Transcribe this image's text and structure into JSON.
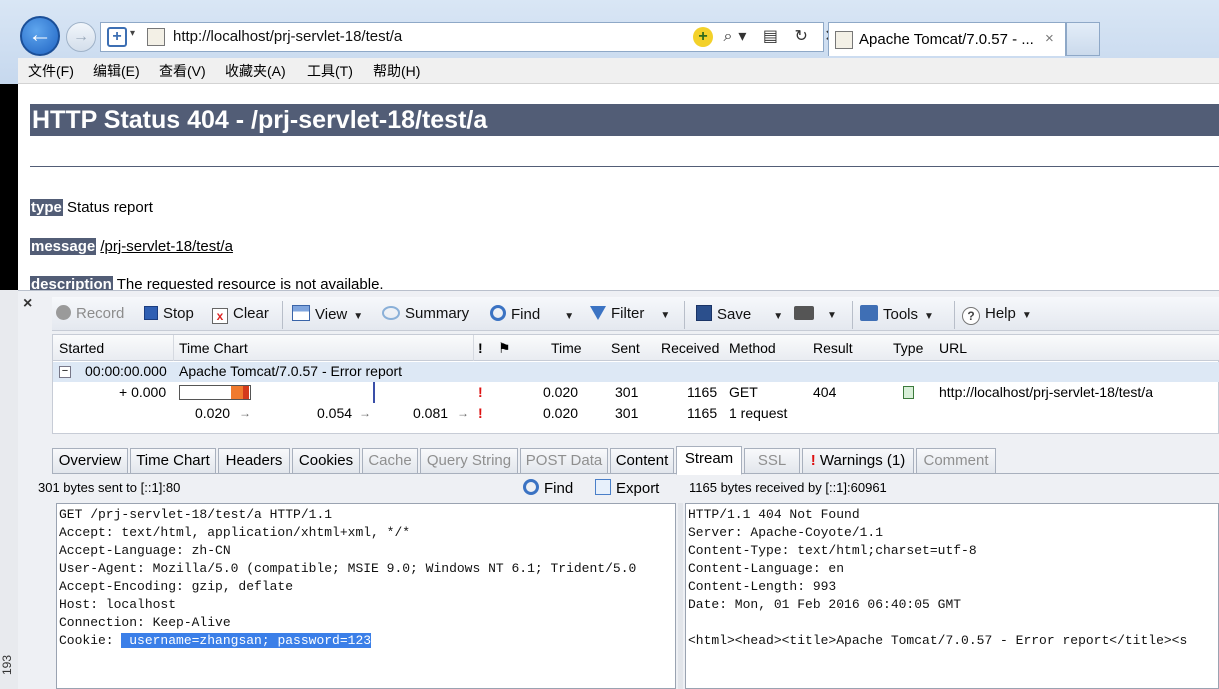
{
  "browser": {
    "url": "http://localhost/prj-servlet-18/test/a",
    "tab_title": "Apache Tomcat/7.0.57 - ...",
    "tab_close": "×",
    "back": "←",
    "forward": "→",
    "compat": "+",
    "compat_dd": "▾",
    "addr_icons": "⌕▾ ▤ ↻ ✕",
    "addr_add": "+",
    "menu": [
      "文件(F)",
      "编辑(E)",
      "查看(V)",
      "收藏夹(A)",
      "工具(T)",
      "帮助(H)"
    ]
  },
  "page": {
    "title": "HTTP Status 404 - /prj-servlet-18/test/a",
    "type_label": "type",
    "type_value": "Status report",
    "message_label": "message",
    "message_value": "/prj-servlet-18/test/a",
    "description_label": "description",
    "description_value": "The requested resource is not available."
  },
  "debugger": {
    "close": "×",
    "toolbar": {
      "record": "Record",
      "stop": "Stop",
      "clear": "Clear",
      "view": "View",
      "summary": "Summary",
      "find": "Find",
      "filter": "Filter",
      "save": "Save",
      "tools": "Tools",
      "help": "Help",
      "dropdown": "▼"
    },
    "columns": [
      "Started",
      "Time Chart",
      "!",
      "Time",
      "Sent",
      "Received",
      "Method",
      "Result",
      "Type",
      "URL"
    ],
    "group_row": {
      "expander": "−",
      "started": "00:00:00.000",
      "title": "Apache Tomcat/7.0.57 - Error report"
    },
    "entry_row": {
      "started": "+ 0.000",
      "flag": "!",
      "time": "0.020",
      "sent": "301",
      "received": "1165",
      "method": "GET",
      "result": "404",
      "url": "http://localhost/prj-servlet-18/test/a"
    },
    "summary_row": {
      "t1": "0.020",
      "t2": "0.054",
      "t3": "0.081",
      "arrow": "→",
      "flag": "!",
      "time": "0.020",
      "sent": "301",
      "received": "1165",
      "method": "1 request"
    },
    "tabs": [
      "Overview",
      "Time Chart",
      "Headers",
      "Cookies",
      "Cache",
      "Query String",
      "POST Data",
      "Content",
      "Stream",
      "SSL",
      "Warnings (1)",
      "Comment"
    ],
    "warn_mark": "!",
    "request_status": "301 bytes sent to [::1]:80",
    "response_status": "1165 bytes received by [::1]:60961",
    "find_label": "Find",
    "export_label": "Export",
    "request_lines": [
      "GET /prj-servlet-18/test/a HTTP/1.1",
      "Accept: text/html, application/xhtml+xml, */*",
      "Accept-Language: zh-CN",
      "User-Agent: Mozilla/5.0 (compatible; MSIE 9.0; Windows NT 6.1; Trident/5.0",
      "Accept-Encoding: gzip, deflate",
      "Host: localhost",
      "Connection: Keep-Alive"
    ],
    "cookie_label": "Cookie: ",
    "cookie_value": " username=zhangsan; password=123",
    "response_lines": [
      "HTTP/1.1 404 Not Found",
      "Server: Apache-Coyote/1.1",
      "Content-Type: text/html;charset=utf-8",
      "Content-Language: en",
      "Content-Length: 993",
      "Date: Mon, 01 Feb 2016 06:40:05 GMT",
      "",
      "<html><head><title>Apache Tomcat/7.0.57 - Error report</title><s"
    ],
    "side_number": "193"
  }
}
